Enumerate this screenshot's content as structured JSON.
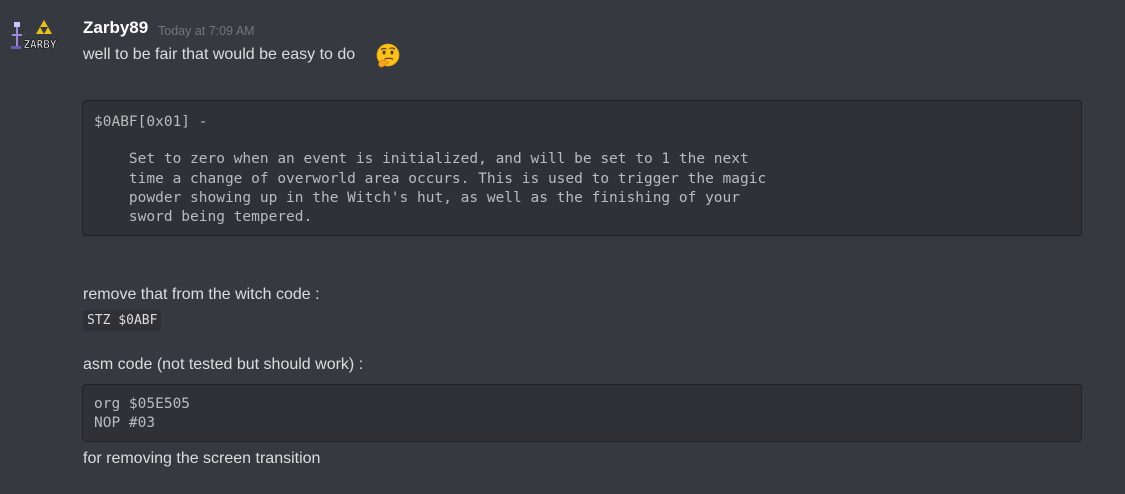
{
  "message": {
    "author": "Zarby89",
    "timestamp": "Today at 7:09 AM",
    "avatar_text": "ZARBY",
    "line1": "well to be fair that would be easy to do",
    "emoji": "thinking-face",
    "code_block_1": {
      "lines": [
        "$0ABF[0x01] -",
        "",
        "    Set to zero when an event is initialized, and will be set to 1 the next",
        "    time a change of overworld area occurs. This is used to trigger the magic",
        "    powder showing up in the Witch's hut, as well as the finishing of your",
        "    sword being tempered."
      ]
    },
    "line2": "remove that from the witch code :",
    "inline_code": "STZ $0ABF",
    "line3": "asm code (not tested but should work) :",
    "code_block_2": {
      "lines": [
        "org $05E505",
        "NOP #03"
      ]
    },
    "line4": "for removing the screen transition"
  }
}
